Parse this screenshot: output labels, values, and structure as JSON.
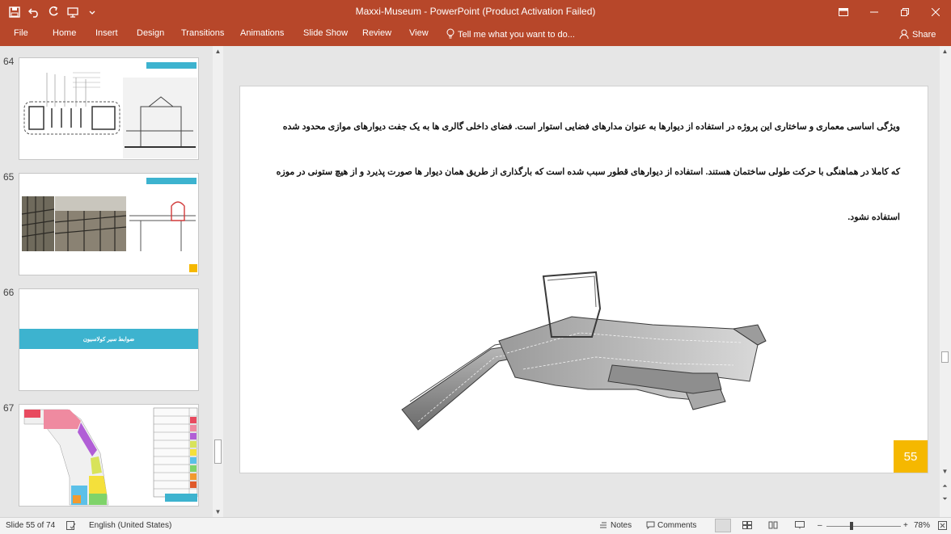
{
  "titlebar": {
    "title": "Maxxi-Museum  -  PowerPoint (Product Activation Failed)"
  },
  "qat_icons": [
    "save-icon",
    "undo-icon",
    "redo-icon",
    "present-icon",
    "customize-icon"
  ],
  "ribbon": {
    "tabs": [
      "File",
      "Home",
      "Insert",
      "Design",
      "Transitions",
      "Animations",
      "Slide Show",
      "Review",
      "View"
    ],
    "tell_me": "Tell me what you want to do...",
    "share": "Share"
  },
  "thumbnails": [
    {
      "number": "64"
    },
    {
      "number": "65"
    },
    {
      "number": "66",
      "banner": "ضوابط سیر کولاسیون"
    },
    {
      "number": "67"
    }
  ],
  "slide": {
    "line1": "ویژگی اساسی معماری و ساختاری این پروژه در استفاده از دیوارها به عنوان مدارهای فضایی استوار است. فضای داخلی گالری ها به یک جفت دیوارهای موازی محدود شده",
    "line2": "که کاملا در هماهنگی با حرکت طولی ساختمان هستند. استفاده از دیوارهای قطور سبب شده است که بارگذاری از طریق همان دیوار ها صورت پذیرد و از هیچ ستونی در موزه",
    "line3": "استفاده نشود.",
    "page_number": "55"
  },
  "statusbar": {
    "slide_info": "Slide 55 of 74",
    "language": "English (United States)",
    "notes": "Notes",
    "comments": "Comments",
    "zoom": "78%"
  },
  "colors": {
    "accent": "#b7472a",
    "teal": "#3db3cf",
    "badge": "#f5b800"
  }
}
